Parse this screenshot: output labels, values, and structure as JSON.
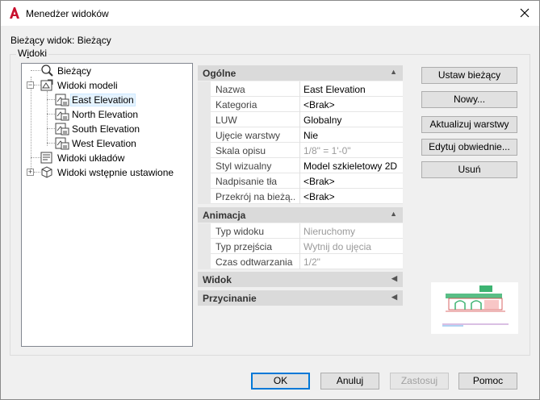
{
  "window": {
    "title": "Menedżer widoków",
    "app_icon": "autocad-a-icon",
    "close_icon": "close-icon"
  },
  "current_view": "Bieżący widok: Bieżący",
  "group": {
    "label": "Widoki"
  },
  "tree": {
    "items": [
      {
        "label": "Bieżący",
        "icon": "magnifier-icon"
      },
      {
        "label": "Widoki modeli",
        "icon": "model-views-icon",
        "expander": "−"
      },
      {
        "label": "East Elevation",
        "icon": "named-view-icon",
        "selected": true
      },
      {
        "label": "North Elevation",
        "icon": "named-view-icon"
      },
      {
        "label": "South Elevation",
        "icon": "named-view-icon"
      },
      {
        "label": "West Elevation",
        "icon": "named-view-icon"
      },
      {
        "label": "Widoki układów",
        "icon": "layout-views-icon"
      },
      {
        "label": "Widoki wstępnie ustawione",
        "icon": "cube-icon",
        "expander": "+"
      }
    ]
  },
  "properties": {
    "general": {
      "title": "Ogólne",
      "arrow": "▲",
      "rows": [
        {
          "name": "Nazwa",
          "value": "East Elevation"
        },
        {
          "name": "Kategoria",
          "value": "<Brak>"
        },
        {
          "name": "LUW",
          "value": "Globalny"
        },
        {
          "name": "Ujęcie warstwy",
          "value": "Nie"
        },
        {
          "name": "Skala opisu",
          "value": "1/8\" = 1'-0\""
        },
        {
          "name": "Styl wizualny",
          "value": "Model szkieletowy 2D"
        },
        {
          "name": "Nadpisanie tła",
          "value": "<Brak>"
        },
        {
          "name": "Przekrój  na  bieżą...",
          "value": "<Brak>"
        }
      ]
    },
    "animation": {
      "title": "Animacja",
      "arrow": "▲",
      "rows": [
        {
          "name": "Typ widoku",
          "value": "Nieruchomy"
        },
        {
          "name": "Typ przejścia",
          "value": "Wytnij do ujęcia"
        },
        {
          "name": "Czas odtwarzania",
          "value": "1/2\""
        }
      ]
    },
    "view": {
      "title": "Widok",
      "arrow": "◀"
    },
    "clipping": {
      "title": "Przycinanie",
      "arrow": "◀"
    }
  },
  "side_buttons": {
    "set_current": "Ustaw bieżący",
    "new": "Nowy...",
    "update_layers": "Aktualizuj warstwy",
    "edit_boundaries": "Edytuj obwiednie...",
    "delete": "Usuń"
  },
  "footer_buttons": {
    "ok": "OK",
    "cancel": "Anuluj",
    "apply": "Zastosuj",
    "help": "Pomoc"
  },
  "colors": {
    "accent": "#0078d7",
    "app_red": "#c8102e",
    "preview_green": "#3cb371"
  }
}
